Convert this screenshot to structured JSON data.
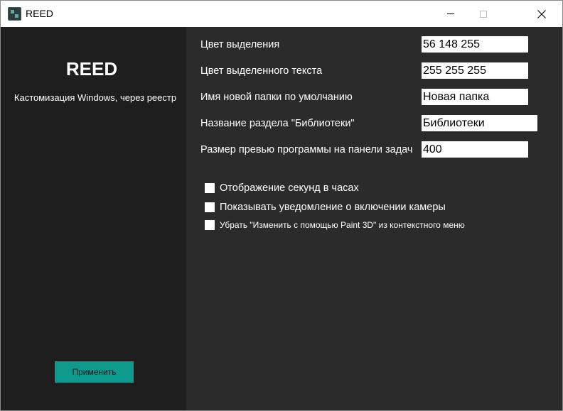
{
  "window": {
    "title": "REED",
    "icon": "app-icon",
    "controls": [
      "minimize-icon",
      "maximize-icon",
      "close-icon"
    ]
  },
  "sidebar": {
    "brand": "REED",
    "subtitle": "Кастомизация Windows, через реестр",
    "apply_label": "Применить"
  },
  "fields": [
    {
      "label": "Цвет выделения",
      "value": "56 148 255"
    },
    {
      "label": "Цвет выделенного текста",
      "value": "255 255 255"
    },
    {
      "label": "Имя новой папки по умолчанию",
      "value": "Новая папка"
    },
    {
      "label": "Название раздела \"Библиотеки\"",
      "value": "Библиотеки"
    },
    {
      "label": "Размер превью программы на панели задач",
      "value": "400"
    }
  ],
  "checkboxes": [
    {
      "label": "Отображение секунд в часах",
      "checked": false
    },
    {
      "label": "Показывать уведомление о включении камеры",
      "checked": false
    },
    {
      "label": "Убрать \"Изменить с помощью Paint 3D\" из контекстного меню",
      "checked": false
    }
  ],
  "colors": {
    "sidebar_bg": "#1e1e1e",
    "content_bg": "#2b2b2b",
    "accent": "#0e9b8e"
  }
}
